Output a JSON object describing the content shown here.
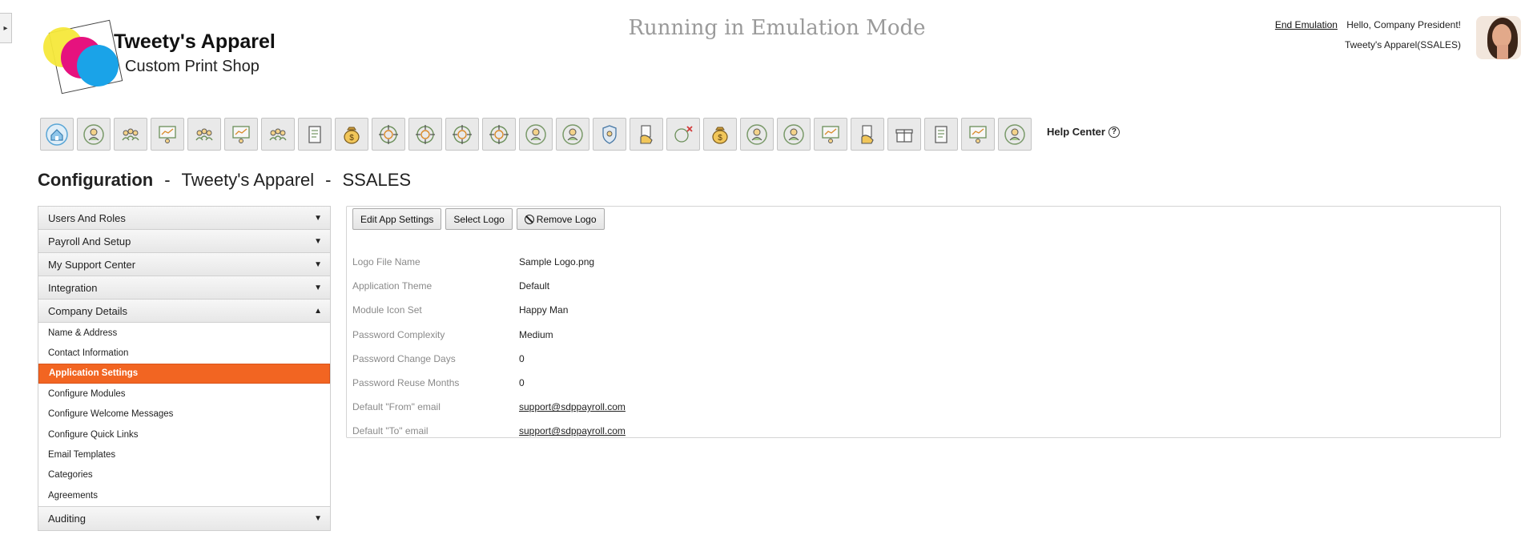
{
  "side_toggle": {
    "glyph": "▸"
  },
  "logo": {
    "title": "Tweety's Apparel",
    "subtitle": "Custom Print Shop"
  },
  "header": {
    "emulation_text": "Running in Emulation Mode",
    "end_emulation": "End Emulation",
    "greeting": "Hello, Company President!",
    "company_line": "Tweety's Apparel(SSALES)"
  },
  "toolbar": {
    "icons": [
      "home-icon",
      "people-icon",
      "people-settings-icon",
      "presentation-icon",
      "team-icon",
      "group-board-icon",
      "org-chart-icon",
      "report-edit-icon",
      "money-bag-icon",
      "target-icon",
      "target-icon-2",
      "target-icon-3",
      "target-icon-4",
      "person-chart-icon",
      "person-growth-icon",
      "shield-hand-icon",
      "hand-document-icon",
      "person-x-icon",
      "money-bag-icon-2",
      "person-group-chart-icon",
      "person-growth-icon-2",
      "people-board-icon",
      "hand-document-icon-2",
      "gift-icon",
      "document-icon",
      "group-board-icon-2",
      "badge-search-icon"
    ],
    "help_center": "Help Center",
    "help_glyph": "?"
  },
  "page_title": {
    "section": "Configuration",
    "sep1": "-",
    "company": "Tweety's Apparel",
    "sep2": "-",
    "code": "SSALES"
  },
  "accordion": {
    "headers": {
      "users_roles": "Users And Roles",
      "payroll_setup": "Payroll And Setup",
      "support_center": "My Support Center",
      "integration": "Integration",
      "company_details": "Company Details",
      "auditing": "Auditing"
    },
    "company_items": [
      "Name & Address",
      "Contact Information",
      "Application Settings",
      "Configure Modules",
      "Configure Welcome Messages",
      "Configure Quick Links",
      "Email Templates",
      "Categories",
      "Agreements"
    ],
    "active_item": "Application Settings",
    "caret_down": "▼",
    "caret_up": "▲"
  },
  "panel": {
    "buttons": {
      "edit": "Edit App Settings",
      "select_logo": "Select Logo",
      "remove_logo": "Remove Logo"
    },
    "settings": [
      {
        "label": "Logo File Name",
        "value": "Sample Logo.png"
      },
      {
        "label": "Application Theme",
        "value": "Default"
      },
      {
        "label": "Module Icon Set",
        "value": "Happy Man"
      },
      {
        "label": "Password Complexity",
        "value": "Medium"
      },
      {
        "label": "Password Change Days",
        "value": "0"
      },
      {
        "label": "Password Reuse Months",
        "value": "0"
      },
      {
        "label": "Default \"From\" email",
        "value": "support@sdppayroll.com"
      },
      {
        "label": "Default \"To\" email",
        "value": "support@sdppayroll.com"
      }
    ]
  },
  "colors": {
    "accent": "#f26522",
    "emulation_gray": "#9a9a9a",
    "logo_yellow": "#f5e83a",
    "logo_magenta": "#e6127e",
    "logo_blue": "#1aa3e8"
  }
}
